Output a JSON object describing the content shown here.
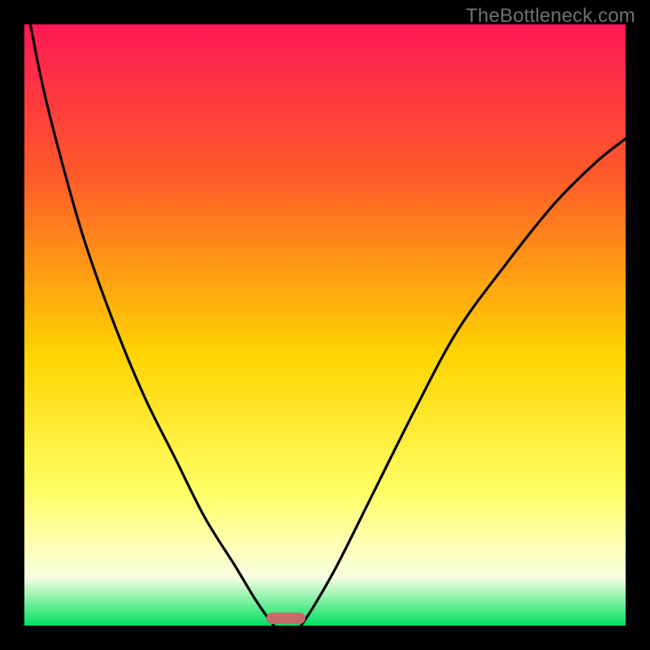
{
  "watermark": "TheBottleneck.com",
  "chart_data": {
    "type": "line",
    "title": "",
    "xlabel": "",
    "ylabel": "",
    "xlim": [
      0,
      100
    ],
    "ylim": [
      0,
      100
    ],
    "gradient_stops": [
      {
        "offset": 0,
        "color": "#ff1855"
      },
      {
        "offset": 25,
        "color": "#ff5a2a"
      },
      {
        "offset": 55,
        "color": "#ffd400"
      },
      {
        "offset": 78,
        "color": "#ffff66"
      },
      {
        "offset": 86,
        "color": "#ffffb0"
      },
      {
        "offset": 92,
        "color": "#f5ffe0"
      },
      {
        "offset": 100,
        "color": "#00e060"
      }
    ],
    "series": [
      {
        "name": "left-curve",
        "x": [
          1,
          3,
          6,
          10,
          15,
          20,
          25,
          30,
          35,
          38,
          40,
          41.5
        ],
        "values": [
          100,
          90,
          78,
          64,
          50,
          38,
          28,
          18,
          10,
          5,
          2,
          0
        ]
      },
      {
        "name": "right-curve",
        "x": [
          46,
          48,
          52,
          58,
          65,
          72,
          80,
          88,
          95,
          100
        ],
        "values": [
          0,
          3,
          10,
          22,
          36,
          49,
          60,
          70,
          77,
          81
        ]
      }
    ],
    "marker": {
      "x_center": 43.5,
      "y": 0,
      "width": 6.5,
      "color": "#c76a6a"
    }
  }
}
